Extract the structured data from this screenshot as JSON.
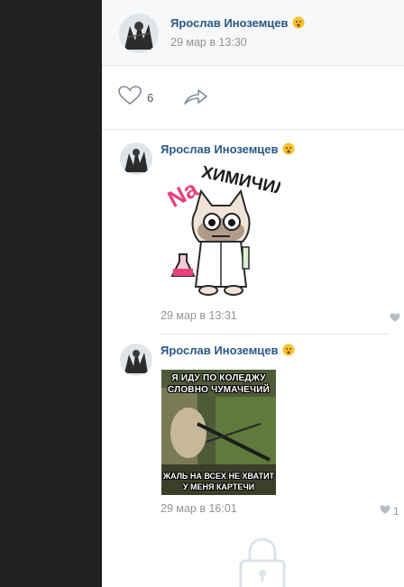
{
  "post": {
    "author": "Ярослав Иноземцев",
    "timestamp": "29 мар в 13:30",
    "likes": "6"
  },
  "comments": [
    {
      "author": "Ярослав Иноземцев",
      "sticker_text": "NaХИМИЧИЛ",
      "timestamp": "29 мар в 13:31"
    },
    {
      "author": "Ярослав Иноземцев",
      "meme_top": "Я ИДУ ПО КОЛЕДЖУ СЛОВНО ЧУМАЧЕЧИЙ",
      "meme_bottom": "ЖАЛЬ НА ВСЕХ НЕ ХВАТИТ У МЕНЯ КАРТЕЧИ",
      "timestamp": "29 мар в 16:01",
      "likes": "1"
    }
  ],
  "icons": {
    "heart": "heart-icon",
    "share": "share-icon",
    "lock": "lock-icon",
    "emoji": "emoji-icon"
  },
  "colors": {
    "author": "#2a5885",
    "muted": "#939393",
    "dark_panel": "#222222"
  }
}
